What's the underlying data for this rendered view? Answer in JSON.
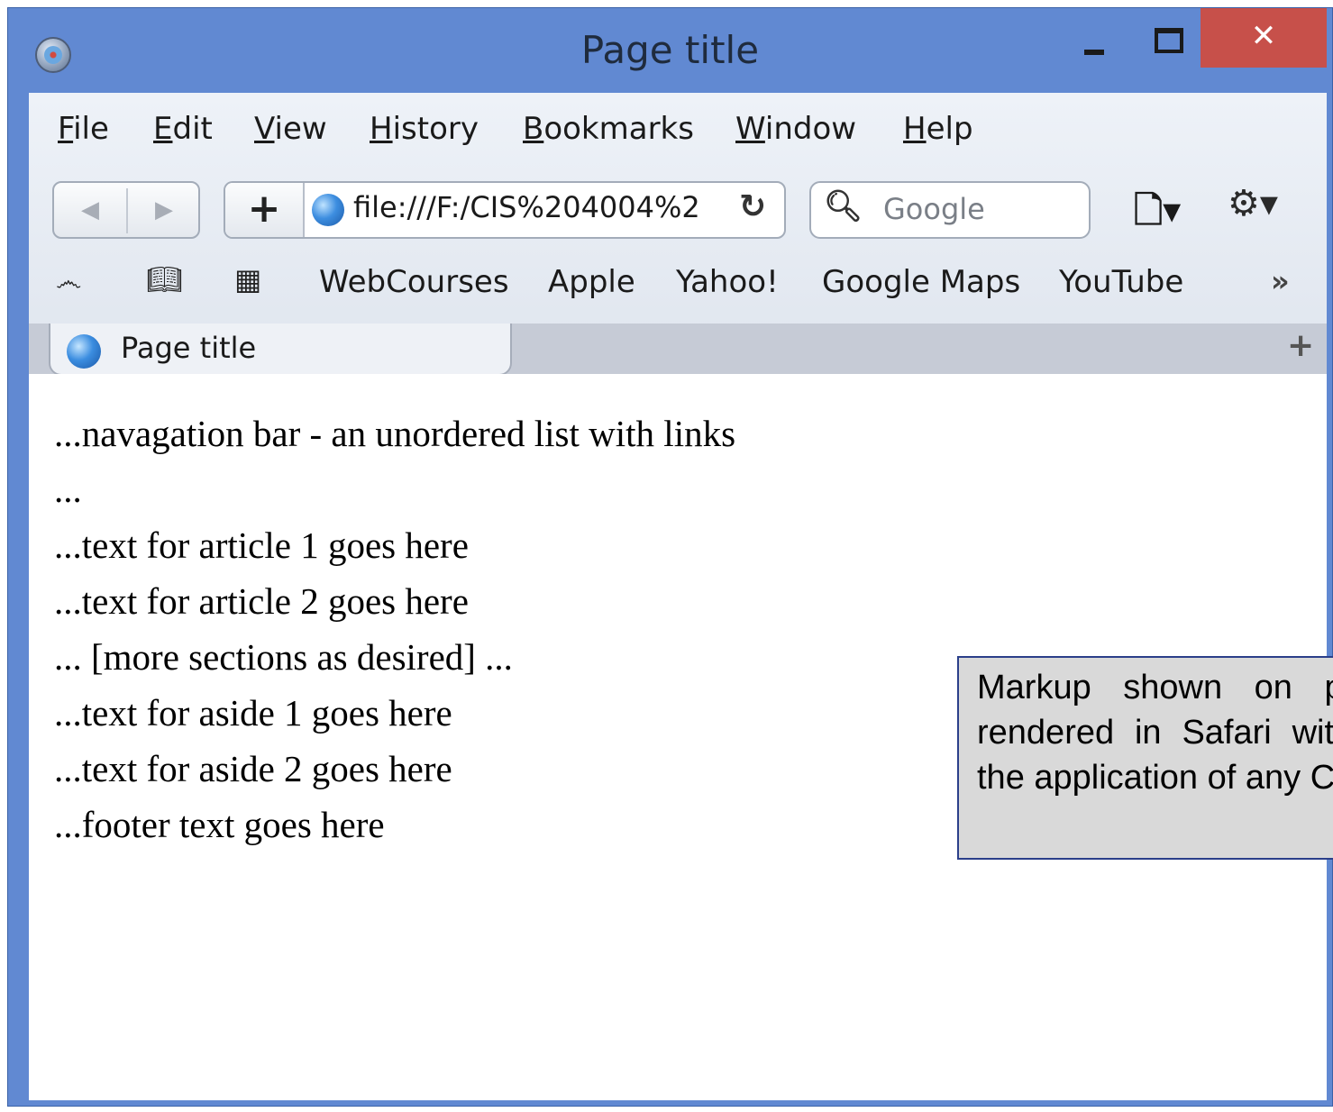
{
  "window": {
    "title": "Page title",
    "close_label": "✕"
  },
  "menu": [
    "File",
    "Edit",
    "View",
    "History",
    "Bookmarks",
    "Window",
    "Help"
  ],
  "toolbar": {
    "add_label": "+",
    "url": "file:///F:/CIS%204004%2",
    "search_placeholder": "Google"
  },
  "bookmarks": [
    "WebCourses",
    "Apple",
    "Yahoo!",
    "Google Maps",
    "YouTube"
  ],
  "tab": {
    "title": "Page title",
    "new_tab_label": "+"
  },
  "content": {
    "lines": [
      "...navagation bar - an unordered list with links",
      "...",
      "...text for article 1 goes here",
      "...text for article 2 goes here",
      "... [more sections as desired] ...",
      "...text for aside 1 goes here",
      "...text for aside 2 goes here",
      "...footer text goes here"
    ]
  },
  "callout": {
    "text": "Markup shown on page rendered in Safari without the application of any CSS."
  },
  "icons": [
    "safari-icon",
    "back-icon",
    "forward-icon",
    "globe-icon",
    "reload-icon",
    "search-icon",
    "page-menu-icon",
    "gear-icon",
    "reading-list-icon",
    "bookmarks-icon",
    "top-sites-icon",
    "chevron-icon"
  ]
}
